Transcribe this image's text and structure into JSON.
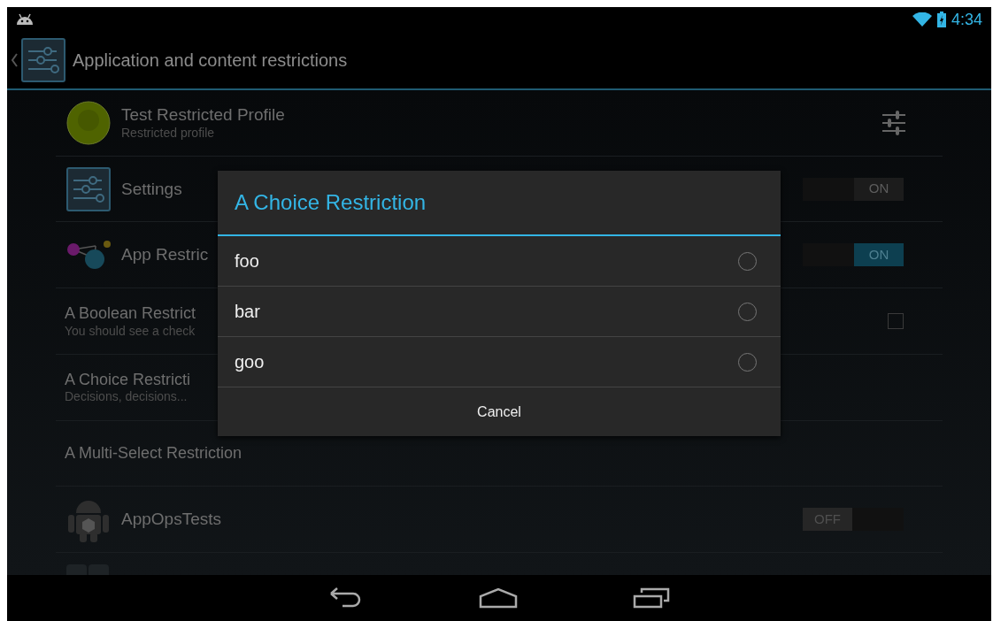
{
  "status_bar": {
    "time": "4:34"
  },
  "action_bar": {
    "title": "Application and content restrictions"
  },
  "list": [
    {
      "kind": "profile",
      "title": "Test Restricted Profile",
      "subtitle": "Restricted profile"
    },
    {
      "kind": "sliders_app",
      "title": "Settings",
      "switch": {
        "label": "ON",
        "on": true,
        "disabled": true
      }
    },
    {
      "kind": "molecule_app",
      "title": "App Restric",
      "switch": {
        "label": "ON",
        "on": true,
        "disabled": false
      }
    },
    {
      "kind": "checkbox",
      "title": "A Boolean Restrict",
      "subtitle": "You should see a check",
      "checked": false
    },
    {
      "kind": "text",
      "title": "A Choice Restricti",
      "subtitle": "Decisions, decisions..."
    },
    {
      "kind": "text",
      "title": "A Multi-Select Restriction"
    },
    {
      "kind": "android_app",
      "title": "AppOpsTests",
      "switch": {
        "label": "OFF",
        "on": false,
        "disabled": false
      }
    },
    {
      "kind": "partial"
    }
  ],
  "dialog": {
    "title": "A Choice Restriction",
    "options": [
      {
        "label": "foo",
        "selected": false
      },
      {
        "label": "bar",
        "selected": false
      },
      {
        "label": "goo",
        "selected": false
      }
    ],
    "cancel": "Cancel"
  }
}
